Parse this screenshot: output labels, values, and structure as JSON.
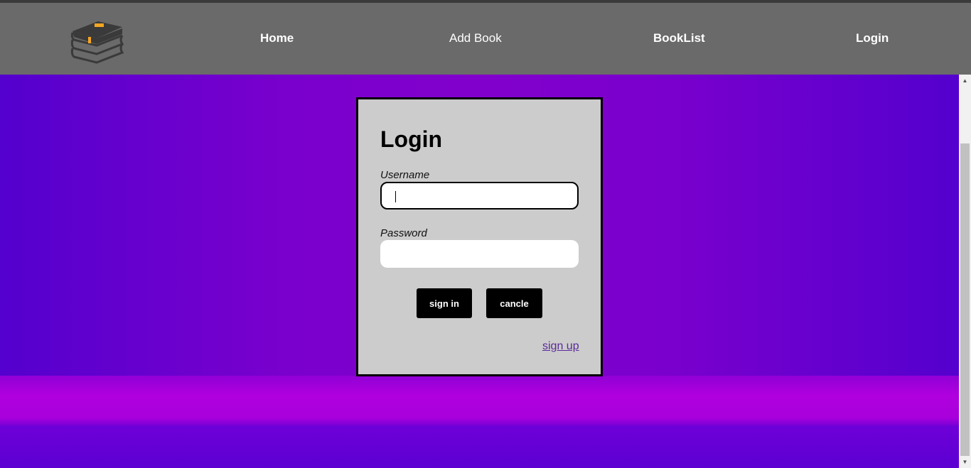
{
  "nav": {
    "logo_icon": "book-stack-icon",
    "links": [
      {
        "label": "Home"
      },
      {
        "label": "Add Book"
      },
      {
        "label": "BookList"
      },
      {
        "label": "Login"
      }
    ]
  },
  "login": {
    "title": "Login",
    "username_label": "Username",
    "username_value": "",
    "password_label": "Password",
    "password_value": "",
    "signin_label": "sign in",
    "cancel_label": "cancle",
    "signup_label": "sign up"
  },
  "colors": {
    "navbar": "#6a6a6a",
    "background_purple": "#7a00cd",
    "card": "#cccccc",
    "button": "#000000",
    "logo_accent": "#f5a623"
  }
}
